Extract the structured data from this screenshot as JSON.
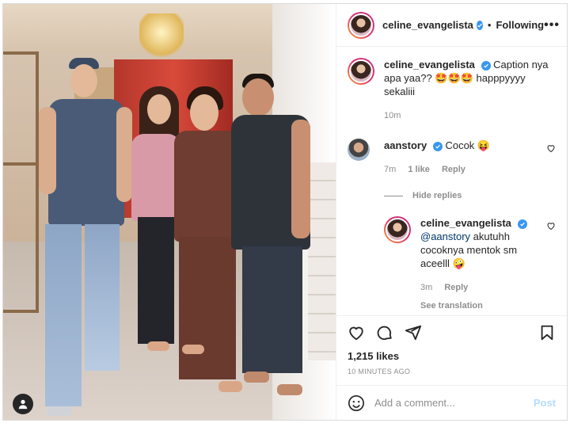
{
  "post": {
    "author": "celine_evangelista",
    "follow_separator": "•",
    "follow_status": "Following",
    "more_label": "•••",
    "caption": "Caption nya apa yaa?? 🤩🤩🤩 happpyyyy sekaliii",
    "caption_time": "10m",
    "likes": "1,215 likes",
    "posted_ago": "10 MINUTES AGO"
  },
  "comments": [
    {
      "user": "aanstory",
      "text": "Cocok 😝",
      "time": "7m",
      "likes": "1 like",
      "reply_label": "Reply"
    }
  ],
  "hide_replies_label": "Hide replies",
  "reply": {
    "user": "celine_evangelista",
    "mention": "@aanstory",
    "text": " akutuhh cocoknya mentok sm aceelll 🤪",
    "time": "3m",
    "reply_label": "Reply",
    "see_translation": "See translation"
  },
  "add_comment": {
    "placeholder": "Add a comment...",
    "post_label": "Post"
  },
  "colors": {
    "verified": "#3897f0",
    "post_button_disabled": "#b3dbff",
    "mention": "#00376b"
  },
  "icons": [
    "heart-icon",
    "comment-icon",
    "share-icon",
    "bookmark-icon",
    "emoji-icon",
    "verified-icon",
    "user-tag-icon"
  ]
}
